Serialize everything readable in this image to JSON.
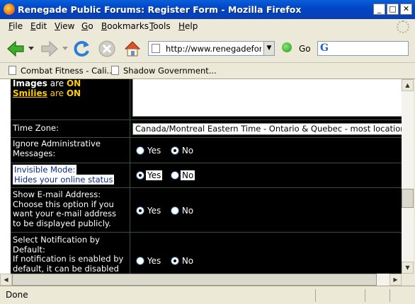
{
  "window": {
    "title": "Renegade Public Forums: Register Form - Mozilla Firefox",
    "minimize_glyph": "_",
    "maximize_glyph": "□",
    "close_glyph": "✕"
  },
  "menu": [
    "File",
    "Edit",
    "View",
    "Go",
    "Bookmarks",
    "Tools",
    "Help"
  ],
  "menu_mnemonics": [
    "F",
    "E",
    "V",
    "G",
    "B",
    "T",
    "H"
  ],
  "nav": {
    "url": "http://www.renegadeforums.com",
    "go_label": "Go",
    "icons": [
      "back-arrow-icon",
      "forward-arrow-icon",
      "reload-icon",
      "stop-icon",
      "home-icon"
    ]
  },
  "bookmarks": [
    "Combat Fitness - Cali...",
    "Shadow Government..."
  ],
  "form": {
    "images_label": "Images",
    "images_are": " are ",
    "images_state": "ON",
    "smilies_label": "Smilies",
    "smilies_are": " are ",
    "smilies_state": "ON",
    "timezone_label": "Time Zone:",
    "timezone_value": "Canada/Montreal Eastern Time - Ontario & Quebec - most locations",
    "ignore_admin_label": "Ignore Administrative Messages:",
    "invisible_label": "Invisible Mode:",
    "invisible_sub": "Hides your online status",
    "show_email_label": "Show E-mail Address:",
    "show_email_desc": "Choose this option if you want your e-mail address to be displayed publicly.",
    "notify_label": "Select Notification by Default:",
    "notify_desc": "If notification is enabled by default, it can be disabled",
    "yes": "Yes",
    "no": "No",
    "selected": {
      "ignore_admin": "No",
      "invisible": "Yes",
      "show_email": "Yes",
      "notify": "No"
    }
  },
  "status": {
    "text": "Done"
  },
  "colors": {
    "forum_bg": "#000000",
    "accent_yellow": "#ffcc00",
    "titlebar": "#0046c8"
  }
}
